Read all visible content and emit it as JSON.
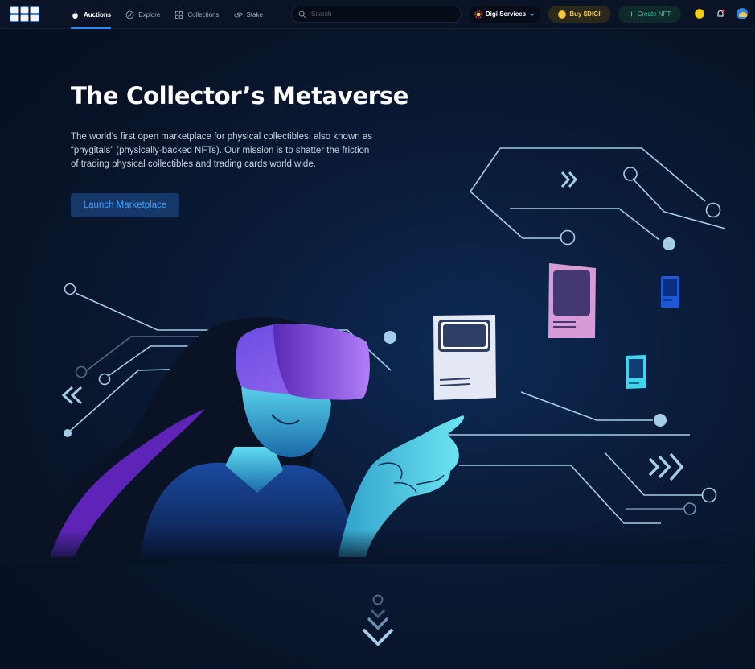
{
  "header": {
    "logo": "digi",
    "nav": [
      {
        "label": "Auctions",
        "icon": "flame-icon",
        "active": true
      },
      {
        "label": "Explore",
        "icon": "compass-icon",
        "active": false
      },
      {
        "label": "Collections",
        "icon": "grid-icon",
        "active": false
      },
      {
        "label": "Stake",
        "icon": "stack-icon",
        "active": false
      }
    ],
    "search": {
      "placeholder": "Search",
      "value": ""
    },
    "services_label": "Digi Services",
    "buy_label": "Buy $DIGI",
    "create_label": "Create NFT",
    "icons": [
      "wallet-coin-icon",
      "notification-icon",
      "profile-avatar"
    ]
  },
  "hero": {
    "title": "The Collector’s Metaverse",
    "description": "The world’s first open marketplace for physical collectibles, also known as “phygitals” (physically-backed NFTs). Our mission is to shatter the friction of trading physical collectibles and trading cards world wide.",
    "cta_label": "Launch Marketplace"
  },
  "colors": {
    "accent": "#2f86ff",
    "buy": "#f7c948",
    "create": "#3cc7a4",
    "background": "#0a1b38"
  }
}
